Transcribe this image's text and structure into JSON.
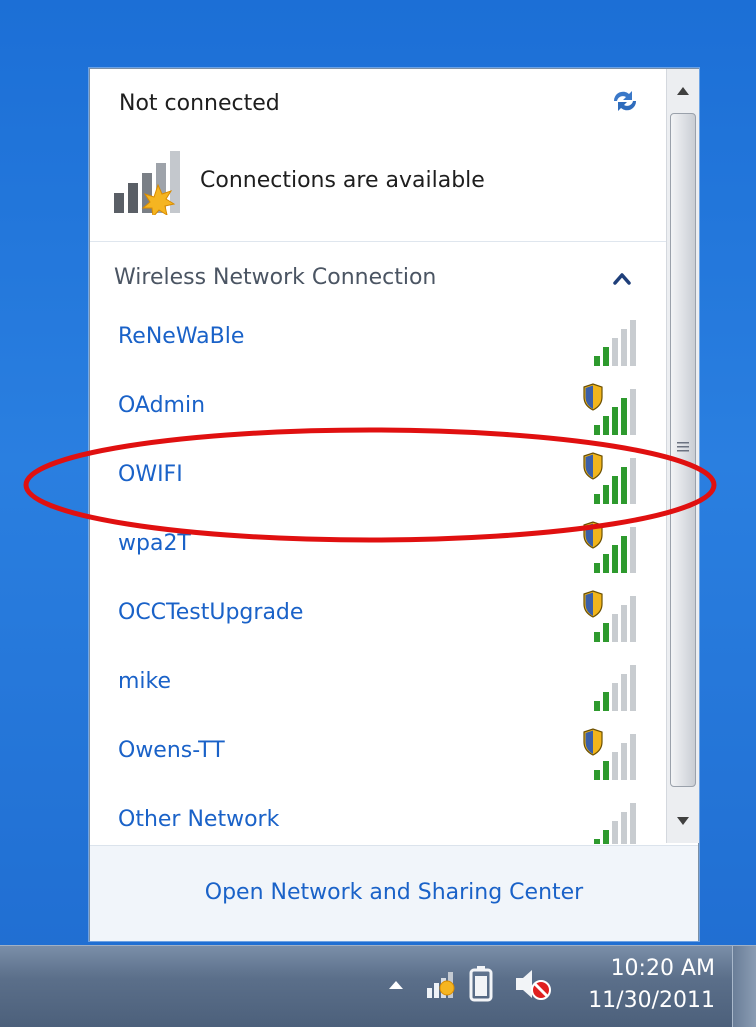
{
  "popup": {
    "status_title": "Not connected",
    "connections_text": "Connections are available",
    "section_label": "Wireless Network Connection",
    "networks": [
      {
        "name": "ReNeWaBle",
        "secured": false,
        "signal_bars": 5,
        "lit_bars": 2
      },
      {
        "name": "OAdmin",
        "secured": true,
        "signal_bars": 5,
        "lit_bars": 4
      },
      {
        "name": "OWIFI",
        "secured": true,
        "signal_bars": 5,
        "lit_bars": 4
      },
      {
        "name": "wpa2T",
        "secured": true,
        "signal_bars": 5,
        "lit_bars": 4
      },
      {
        "name": "OCCTestUpgrade",
        "secured": true,
        "signal_bars": 5,
        "lit_bars": 2
      },
      {
        "name": "mike",
        "secured": false,
        "signal_bars": 5,
        "lit_bars": 2
      },
      {
        "name": "Owens-TT",
        "secured": true,
        "signal_bars": 5,
        "lit_bars": 2
      },
      {
        "name": "Other Network",
        "secured": false,
        "signal_bars": 5,
        "lit_bars": 2
      }
    ],
    "footer_link": "Open Network and Sharing Center"
  },
  "taskbar": {
    "time": "10:20 AM",
    "date": "11/30/2011"
  },
  "icons": {
    "refresh": "refresh-icon",
    "connections": "signal-star-icon",
    "chevron": "chevron-up-icon",
    "secured": "shield-icon",
    "battery": "battery-icon",
    "volume": "volume-muted-icon"
  },
  "colors": {
    "link": "#1a62c8",
    "signal_on": "#2e9a2e",
    "signal_off": "#c8ccd0",
    "highlight": "#e01010"
  }
}
